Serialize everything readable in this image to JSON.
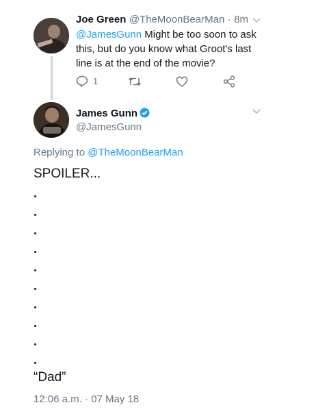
{
  "reply_tweet": {
    "author_name": "Joe Green",
    "author_handle": "@TheMoonBearMan",
    "separator": "·",
    "time": "8m",
    "mention": "@JamesGunn",
    "text_rest": " Might be too soon to ask this, but do you know what Groot's last line is at the end of the movie?",
    "reply_count": "1",
    "icons": [
      "reply-icon",
      "retweet-icon",
      "like-icon",
      "share-icon"
    ]
  },
  "main_tweet": {
    "author_name": "James Gunn",
    "author_handle": "@JamesGunn",
    "verified": true,
    "replying_prefix": "Replying to ",
    "replying_to": "@TheMoonBearMan",
    "headline": "SPOILER...",
    "dots": [
      ".",
      ".",
      ".",
      ".",
      ".",
      ".",
      ".",
      ".",
      ".",
      "."
    ],
    "quote": "“Dad”",
    "timestamp": "12:06 a.m. · 07 May 18"
  },
  "colors": {
    "link": "#1da1f2",
    "muted": "#657786",
    "text": "#14171a",
    "thread_line": "#ccd6dd"
  }
}
